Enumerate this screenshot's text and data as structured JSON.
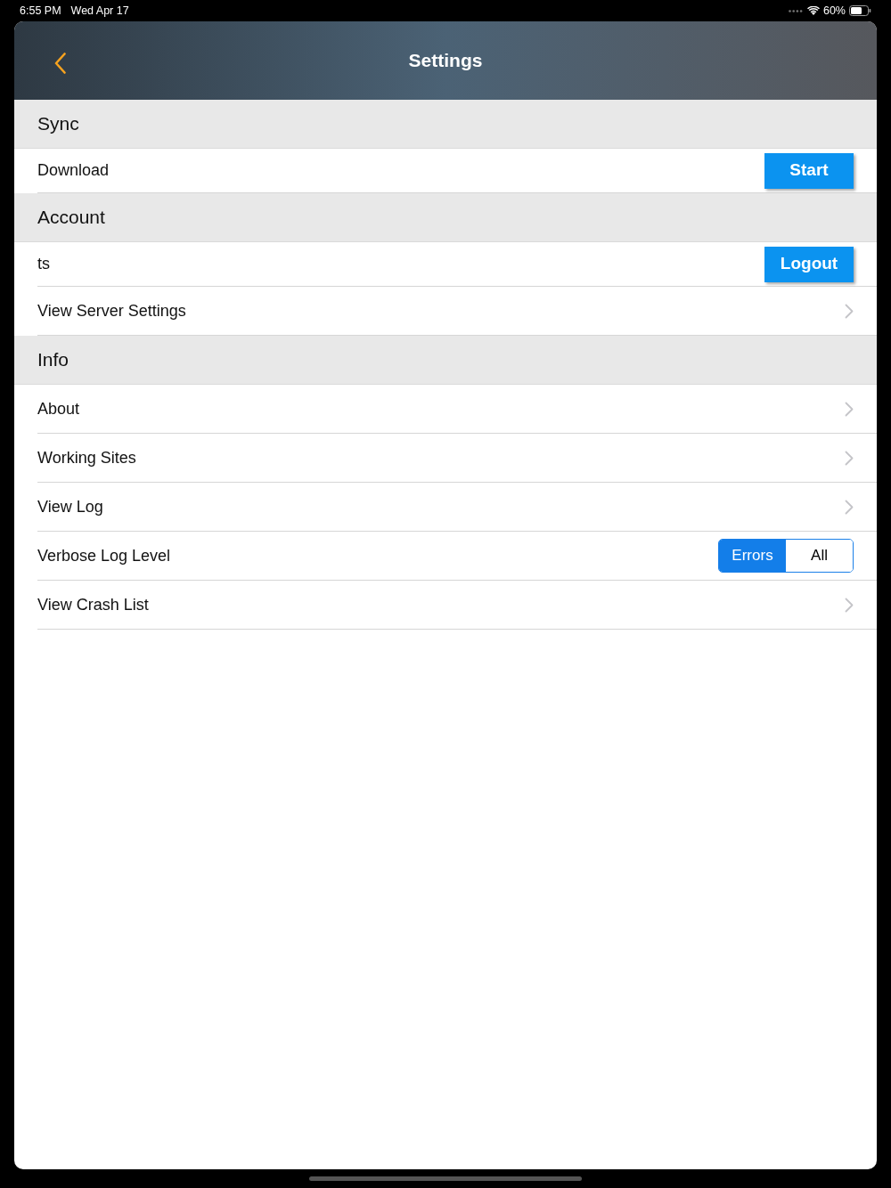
{
  "status_bar": {
    "time": "6:55 PM",
    "date": "Wed Apr 17",
    "battery": "60%"
  },
  "nav_bar": {
    "title": "Settings"
  },
  "sections": [
    {
      "title": "Sync",
      "rows": [
        {
          "kind": "button",
          "label": "Download",
          "button": "Start"
        }
      ]
    },
    {
      "title": "Account",
      "rows": [
        {
          "kind": "button",
          "label": "ts",
          "button": "Logout"
        },
        {
          "kind": "link",
          "label": "View Server Settings"
        }
      ]
    },
    {
      "title": "Info",
      "rows": [
        {
          "kind": "link",
          "label": "About"
        },
        {
          "kind": "link",
          "label": "Working Sites"
        },
        {
          "kind": "link",
          "label": "View Log"
        },
        {
          "kind": "segmented",
          "label": "Verbose Log Level",
          "options": [
            {
              "label": "Errors",
              "selected": true
            },
            {
              "label": "All",
              "selected": false
            }
          ]
        },
        {
          "kind": "link",
          "label": "View Crash List"
        }
      ]
    }
  ]
}
